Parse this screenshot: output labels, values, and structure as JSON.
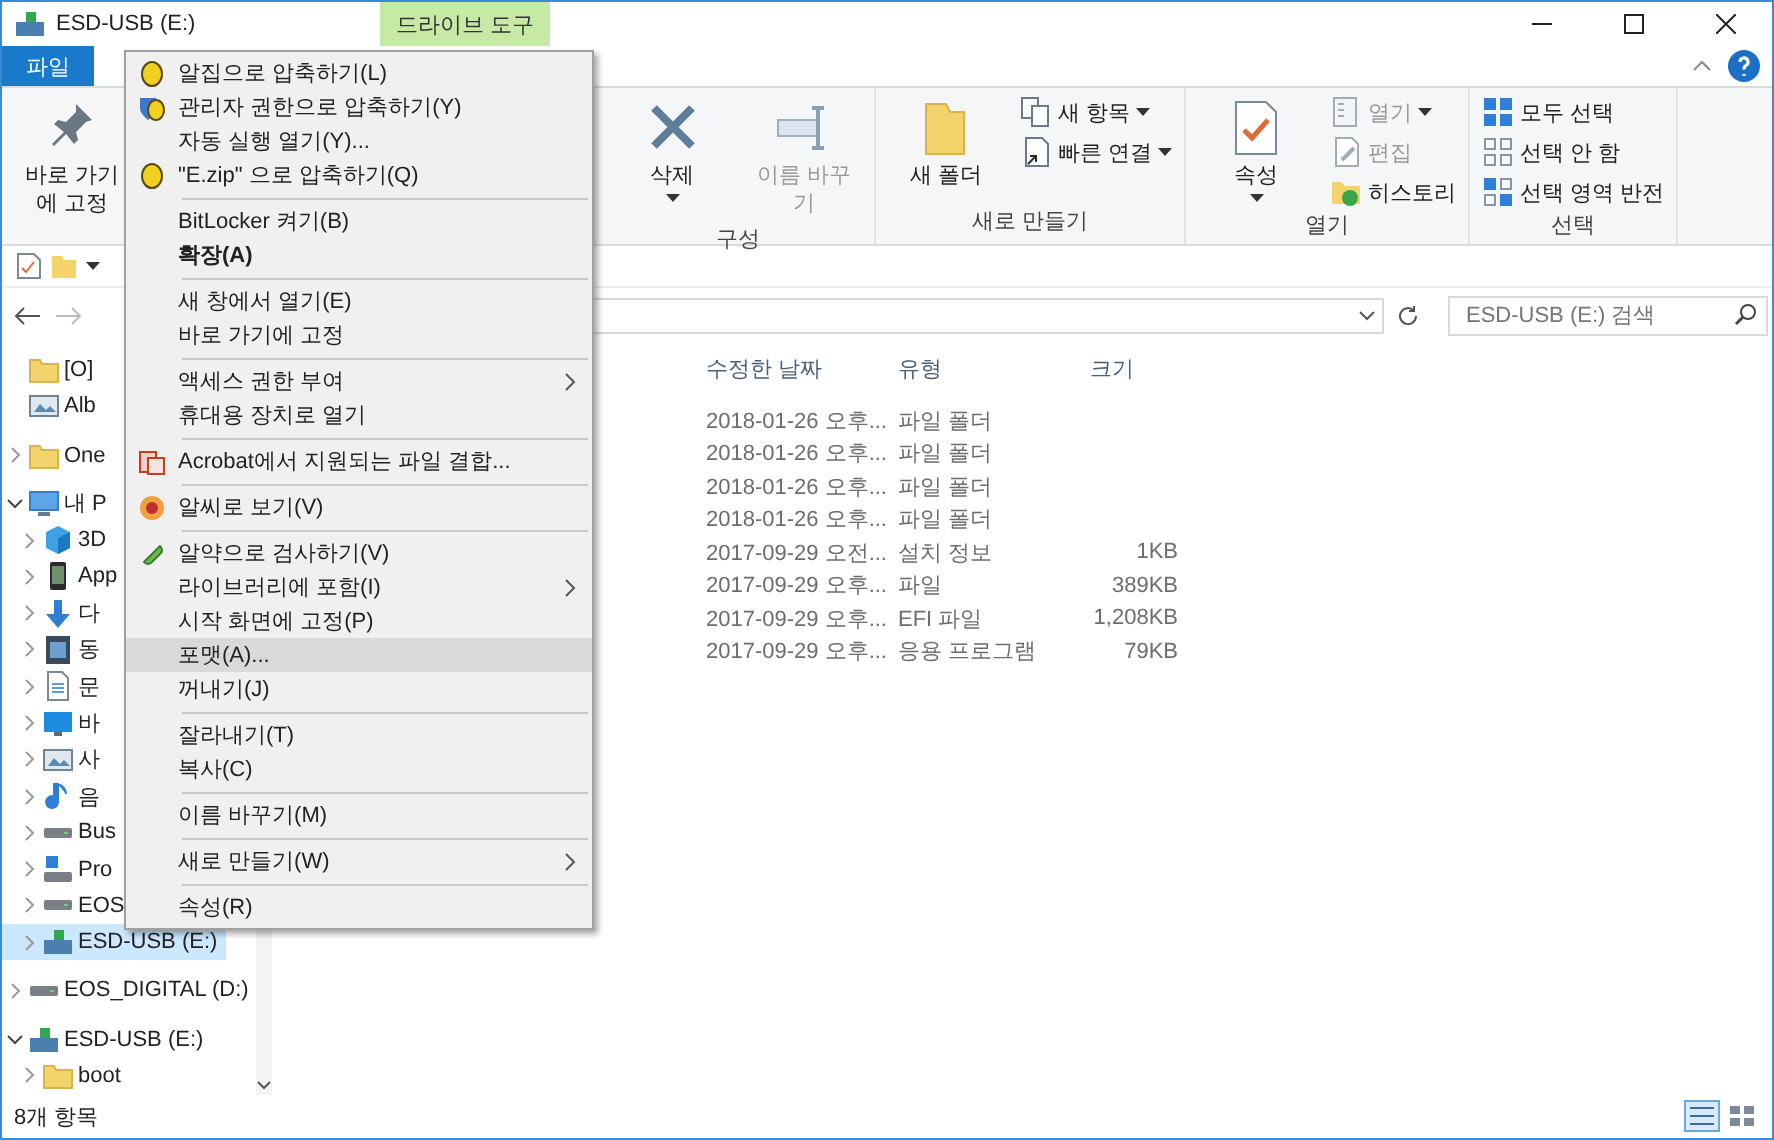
{
  "window": {
    "title": "ESD-USB (E:)",
    "context_tab": "드라이브 도구"
  },
  "ribbon_tabs": [
    {
      "label": "파일",
      "selected": true
    }
  ],
  "ribbon": {
    "groups": [
      {
        "large": [
          {
            "label": "바로 가기에 고정",
            "kind": "pin",
            "disabled": false,
            "dropdown": false
          }
        ]
      },
      {
        "label": "구성",
        "large": [
          {
            "label": "삭제",
            "kind": "delete",
            "disabled": false,
            "dropdown": true
          },
          {
            "label": "이름 바꾸기",
            "kind": "rename",
            "disabled": true,
            "dropdown": false
          }
        ]
      },
      {
        "label": "새로 만들기",
        "large": [
          {
            "label": "새 폴더",
            "kind": "new-folder",
            "disabled": false,
            "dropdown": false
          }
        ],
        "small": [
          {
            "label": "새 항목",
            "kind": "new-item",
            "disabled": false,
            "dropdown": true
          },
          {
            "label": "빠른 연결",
            "kind": "shortcut",
            "disabled": false,
            "dropdown": true
          }
        ]
      },
      {
        "label": "열기",
        "large": [
          {
            "label": "속성",
            "kind": "properties",
            "disabled": false,
            "dropdown": true
          }
        ],
        "small": [
          {
            "label": "열기",
            "kind": "open",
            "disabled": true,
            "dropdown": true
          },
          {
            "label": "편집",
            "kind": "edit",
            "disabled": true,
            "dropdown": false
          },
          {
            "label": "히스토리",
            "kind": "history",
            "disabled": false,
            "dropdown": false
          }
        ]
      },
      {
        "label": "선택",
        "small": [
          {
            "label": "모두 선택",
            "kind": "select-all",
            "disabled": false,
            "dropdown": false
          },
          {
            "label": "선택 안 함",
            "kind": "select-none",
            "disabled": false,
            "dropdown": false
          },
          {
            "label": "선택 영역 반전",
            "kind": "invert",
            "disabled": false,
            "dropdown": false
          }
        ]
      }
    ]
  },
  "search": {
    "placeholder": "ESD-USB (E:) 검색"
  },
  "sidebar": {
    "items": [
      {
        "label": "[O]",
        "kind": "folder",
        "selected": false
      },
      {
        "label": "Alb",
        "kind": "image-drive",
        "selected": false
      },
      {
        "label": "One",
        "kind": "folder",
        "selected": false,
        "expanded": false,
        "gap": true
      },
      {
        "label": "내 P",
        "kind": "pc",
        "selected": false,
        "expanded": true,
        "gap": true,
        "children": [
          {
            "label": "3D",
            "kind": "cube",
            "selected": false,
            "expanded": false
          },
          {
            "label": "App",
            "kind": "phone",
            "selected": false,
            "expanded": false
          },
          {
            "label": "다",
            "kind": "download",
            "selected": false,
            "expanded": false
          },
          {
            "label": "동",
            "kind": "video",
            "selected": false,
            "expanded": false
          },
          {
            "label": "문",
            "kind": "document",
            "selected": false,
            "expanded": false
          },
          {
            "label": "바",
            "kind": "desktop",
            "selected": false,
            "expanded": false
          },
          {
            "label": "사",
            "kind": "image-drive",
            "selected": false,
            "expanded": false
          },
          {
            "label": "음",
            "kind": "music",
            "selected": false,
            "expanded": false
          },
          {
            "label": "Bus",
            "kind": "drive",
            "selected": false,
            "expanded": false
          },
          {
            "label": "Pro",
            "kind": "network-drive",
            "selected": false,
            "expanded": false
          },
          {
            "label": "EOS",
            "kind": "drive",
            "selected": false,
            "expanded": false
          },
          {
            "label": "ESD-USB (E:)",
            "kind": "usb-drive",
            "selected": true,
            "expanded": false
          }
        ]
      },
      {
        "label": "EOS_DIGITAL (D:)",
        "kind": "drive",
        "selected": false,
        "expanded": false,
        "gap": true
      },
      {
        "label": "ESD-USB (E:)",
        "kind": "usb-drive",
        "selected": false,
        "expanded": true,
        "gap": true,
        "children": [
          {
            "label": "boot",
            "kind": "folder",
            "selected": false,
            "expanded": false
          }
        ]
      }
    ]
  },
  "table": {
    "columns": [
      "수정한 날짜",
      "유형",
      "크기"
    ],
    "rows": [
      [
        "2018-01-26 오후...",
        "파일 폴더",
        ""
      ],
      [
        "2018-01-26 오후...",
        "파일 폴더",
        ""
      ],
      [
        "2018-01-26 오후...",
        "파일 폴더",
        ""
      ],
      [
        "2018-01-26 오후...",
        "파일 폴더",
        ""
      ],
      [
        "2017-09-29 오전...",
        "설치 정보",
        "1KB"
      ],
      [
        "2017-09-29 오후...",
        "파일",
        "389KB"
      ],
      [
        "2017-09-29 오후...",
        "EFI 파일",
        "1,208KB"
      ],
      [
        "2017-09-29 오후...",
        "응용 프로그램",
        "79KB"
      ]
    ]
  },
  "context_menu": {
    "items": [
      {
        "kind": "zip",
        "label": "알집으로 압축하기(L)",
        "default": false,
        "selected": false
      },
      {
        "kind": "zip-admin",
        "label": "관리자 권한으로 압축하기(Y)",
        "default": false,
        "selected": false
      },
      {
        "kind": "plain",
        "label": "자동 실행 열기(Y)...",
        "default": false,
        "selected": false
      },
      {
        "kind": "zip",
        "label": "\"E.zip\" 으로 압축하기(Q)",
        "default": false,
        "selected": false
      },
      {
        "kind": "separator"
      },
      {
        "kind": "plain",
        "label": "BitLocker 켜기(B)",
        "default": false,
        "selected": false
      },
      {
        "kind": "plain",
        "label": "확장(A)",
        "default": true,
        "selected": false
      },
      {
        "kind": "separator"
      },
      {
        "kind": "plain",
        "label": "새 창에서 열기(E)",
        "default": false,
        "selected": false
      },
      {
        "kind": "plain",
        "label": "바로 가기에 고정",
        "default": false,
        "selected": false
      },
      {
        "kind": "separator"
      },
      {
        "kind": "submenu",
        "label": "액세스 권한 부여",
        "default": false,
        "selected": false
      },
      {
        "kind": "plain",
        "label": "휴대용 장치로 열기",
        "default": false,
        "selected": false
      },
      {
        "kind": "separator"
      },
      {
        "kind": "pdf",
        "label": "Acrobat에서 지원되는 파일 결합...",
        "default": false,
        "selected": false
      },
      {
        "kind": "separator"
      },
      {
        "kind": "viewer",
        "label": "알씨로 보기(V)",
        "default": false,
        "selected": false
      },
      {
        "kind": "separator"
      },
      {
        "kind": "pill",
        "label": "알약으로 검사하기(V)",
        "default": false,
        "selected": false
      },
      {
        "kind": "submenu",
        "label": "라이브러리에 포함(I)",
        "default": false,
        "selected": false
      },
      {
        "kind": "plain",
        "label": "시작 화면에 고정(P)",
        "default": false,
        "selected": false
      },
      {
        "kind": "plain",
        "label": "포맷(A)...",
        "default": false,
        "selected": true
      },
      {
        "kind": "plain",
        "label": "꺼내기(J)",
        "default": false,
        "selected": false
      },
      {
        "kind": "separator"
      },
      {
        "kind": "plain",
        "label": "잘라내기(T)",
        "default": false,
        "selected": false
      },
      {
        "kind": "plain",
        "label": "복사(C)",
        "default": false,
        "selected": false
      },
      {
        "kind": "separator"
      },
      {
        "kind": "plain",
        "label": "이름 바꾸기(M)",
        "default": false,
        "selected": false
      },
      {
        "kind": "separator"
      },
      {
        "kind": "submenu",
        "label": "새로 만들기(W)",
        "default": false,
        "selected": false
      },
      {
        "kind": "separator"
      },
      {
        "kind": "plain",
        "label": "속성(R)",
        "default": false,
        "selected": false
      }
    ]
  },
  "status_bar": {
    "text": "8개 항목",
    "views": [
      {
        "kind": "details",
        "selected": true
      },
      {
        "kind": "large-icons",
        "selected": false
      }
    ]
  }
}
